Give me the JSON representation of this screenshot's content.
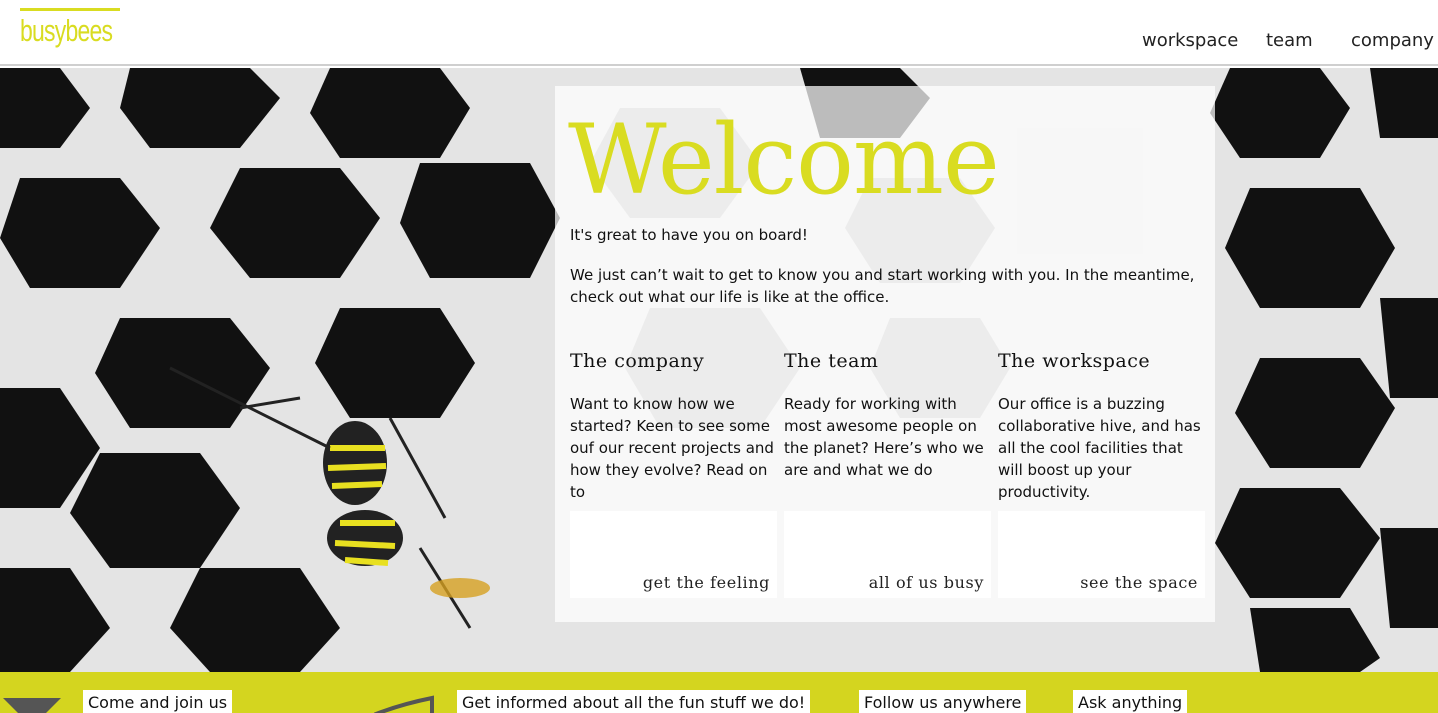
{
  "header": {
    "logo_text": "busybees",
    "nav": [
      "workspace",
      "team",
      "company"
    ]
  },
  "hero": {
    "title": "Welcome",
    "intro": "It's great to have you on board!",
    "intro2": "We just can’t wait to get to know you and start working with you. In the meantime, check out what our life is like at the office.",
    "columns": [
      {
        "heading": "The company",
        "text": "Want to know how we started? Keen to see some ouf our recent projects and how they evolve? Read on to",
        "button": "get the feeling"
      },
      {
        "heading": "The team",
        "text": "Ready for working with most awesome people on the planet? Here’s who we are and what we do",
        "button": "all of us busy"
      },
      {
        "heading": "The workspace",
        "text": "Our office is a buzzing collaborative hive, and has all the cool facilities that will boost up your productivity.",
        "button": "see the space"
      }
    ]
  },
  "footer": {
    "items": [
      "Come and join us",
      "Get informed about all the fun stuff we do!",
      "Follow us anywhere",
      "Ask anything"
    ]
  },
  "colors": {
    "accent": "#d9dc21",
    "footer_bg": "#d4d51f"
  }
}
